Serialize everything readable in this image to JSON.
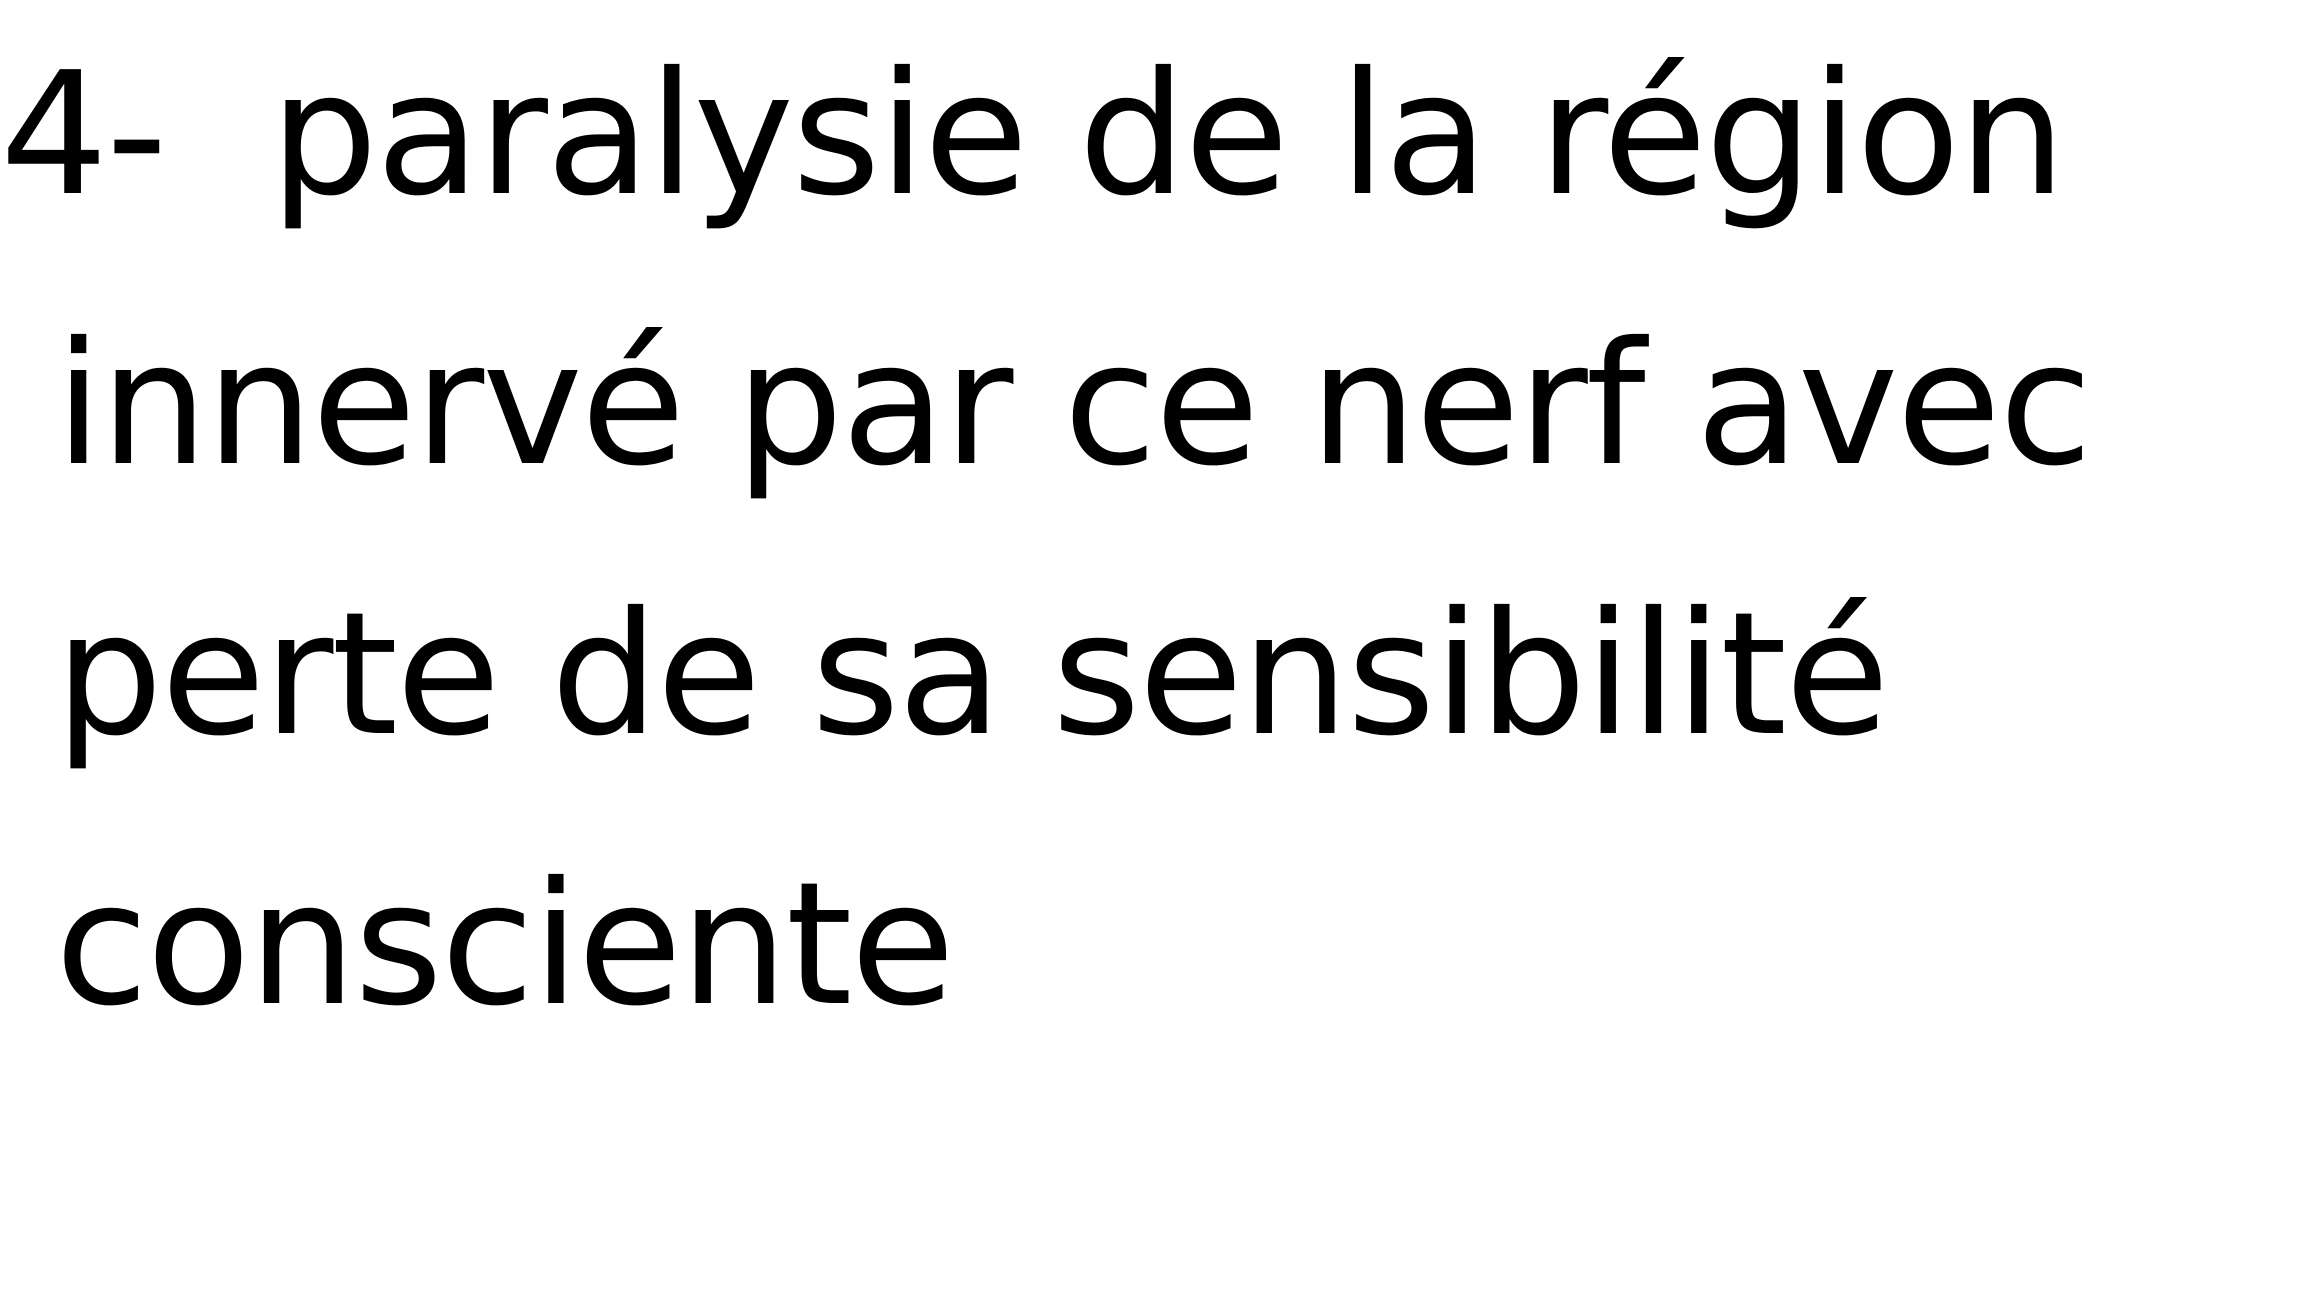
{
  "content": {
    "number": "4-",
    "lines": [
      "paralysie de la région",
      "innervé par ce nerf avec",
      "perte de sa sensibilité",
      "consciente"
    ]
  },
  "colors": {
    "text": "#000000",
    "background": "#ffffff"
  }
}
